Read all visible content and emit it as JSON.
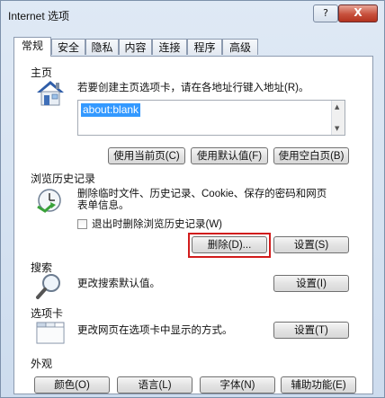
{
  "window": {
    "title": "Internet 选项",
    "help_label": "?",
    "close_label": "X"
  },
  "tabs": [
    "常规",
    "安全",
    "隐私",
    "内容",
    "连接",
    "程序",
    "高级"
  ],
  "home": {
    "label": "主页",
    "description": "若要创建主页选项卡，请在各地址行键入地址(R)。",
    "address_value": "about:blank",
    "buttons": {
      "current": "使用当前页(C)",
      "default": "使用默认值(F)",
      "blank": "使用空白页(B)"
    }
  },
  "history": {
    "label": "浏览历史记录",
    "description_line1": "删除临时文件、历史记录、Cookie、保存的密码和网页",
    "description_line2": "表单信息。",
    "checkbox_label": "退出时删除浏览历史记录(W)",
    "delete_button": "删除(D)...",
    "settings_button": "设置(S)"
  },
  "search": {
    "label": "搜索",
    "description": "更改搜索默认值。",
    "settings_button": "设置(I)"
  },
  "tabs_section": {
    "label": "选项卡",
    "description": "更改网页在选项卡中显示的方式。",
    "settings_button": "设置(T)"
  },
  "appearance": {
    "label": "外观",
    "buttons": [
      "颜色(O)",
      "语言(L)",
      "字体(N)",
      "辅助功能(E)"
    ]
  },
  "colors": {
    "highlight": "#d21c1c",
    "selection": "#3399ff",
    "close_button": "#c7513d"
  }
}
